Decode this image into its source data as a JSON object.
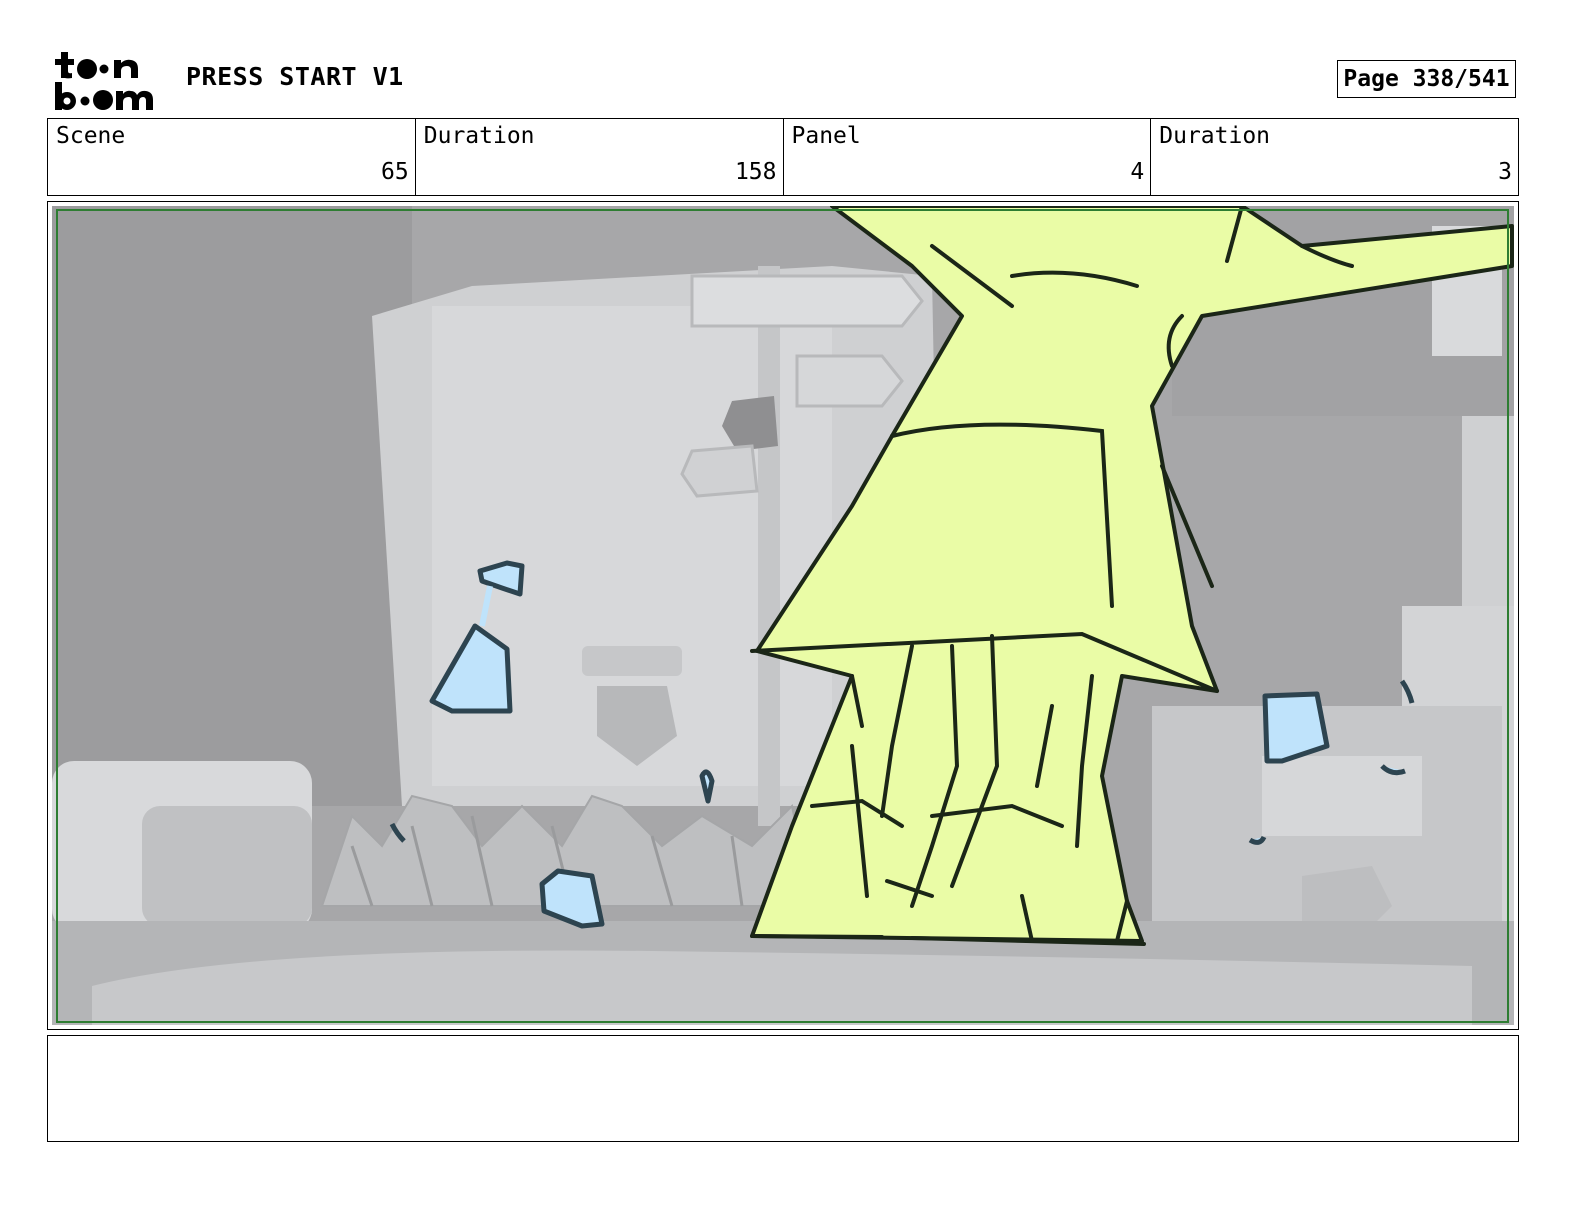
{
  "header": {
    "logo_text": "toon boom",
    "project_title": "PRESS START V1",
    "page_label": "Page 338/541"
  },
  "info": {
    "scene_label": "Scene",
    "scene_value": "65",
    "scene_duration_label": "Duration",
    "scene_duration_value": "158",
    "panel_label": "Panel",
    "panel_value": "4",
    "panel_duration_label": "Duration",
    "panel_duration_value": "3"
  },
  "panel": {
    "safe_area_color": "#2e7d32",
    "character_fill": "#eafca6",
    "water_fill": "#bfe3fb",
    "line_color": "#1b2617"
  },
  "notes": {
    "text": ""
  }
}
